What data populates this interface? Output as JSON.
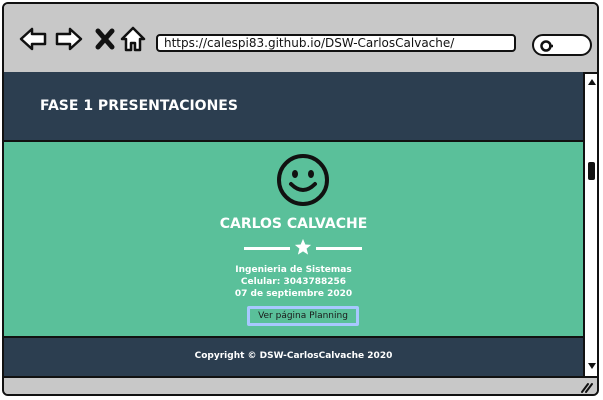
{
  "browser": {
    "url": "https://calespi83.github.io/DSW-CarlosCalvache/",
    "icons": [
      "back-arrow-icon",
      "forward-arrow-icon",
      "close-icon",
      "home-icon",
      "search-icon"
    ]
  },
  "page": {
    "header": {
      "title": "FASE 1 PRESENTACIONES"
    },
    "hero": {
      "avatar_icon": "smiley-face-icon",
      "name": "CARLOS CALVACHE",
      "divider_icon": "star-icon",
      "lines": [
        "Ingenieria de Sistemas",
        "Celular: 3043788256",
        "07 de septiembre 2020"
      ],
      "button_label": "Ver página Planning"
    },
    "footer": {
      "text": "Copyright © DSW-CarlosCalvache 2020"
    }
  },
  "colors": {
    "header_bg": "#2c3e50",
    "hero_bg": "#5ac09a",
    "button_border": "#a8c8ff",
    "chrome_bg": "#c8c8c8"
  }
}
